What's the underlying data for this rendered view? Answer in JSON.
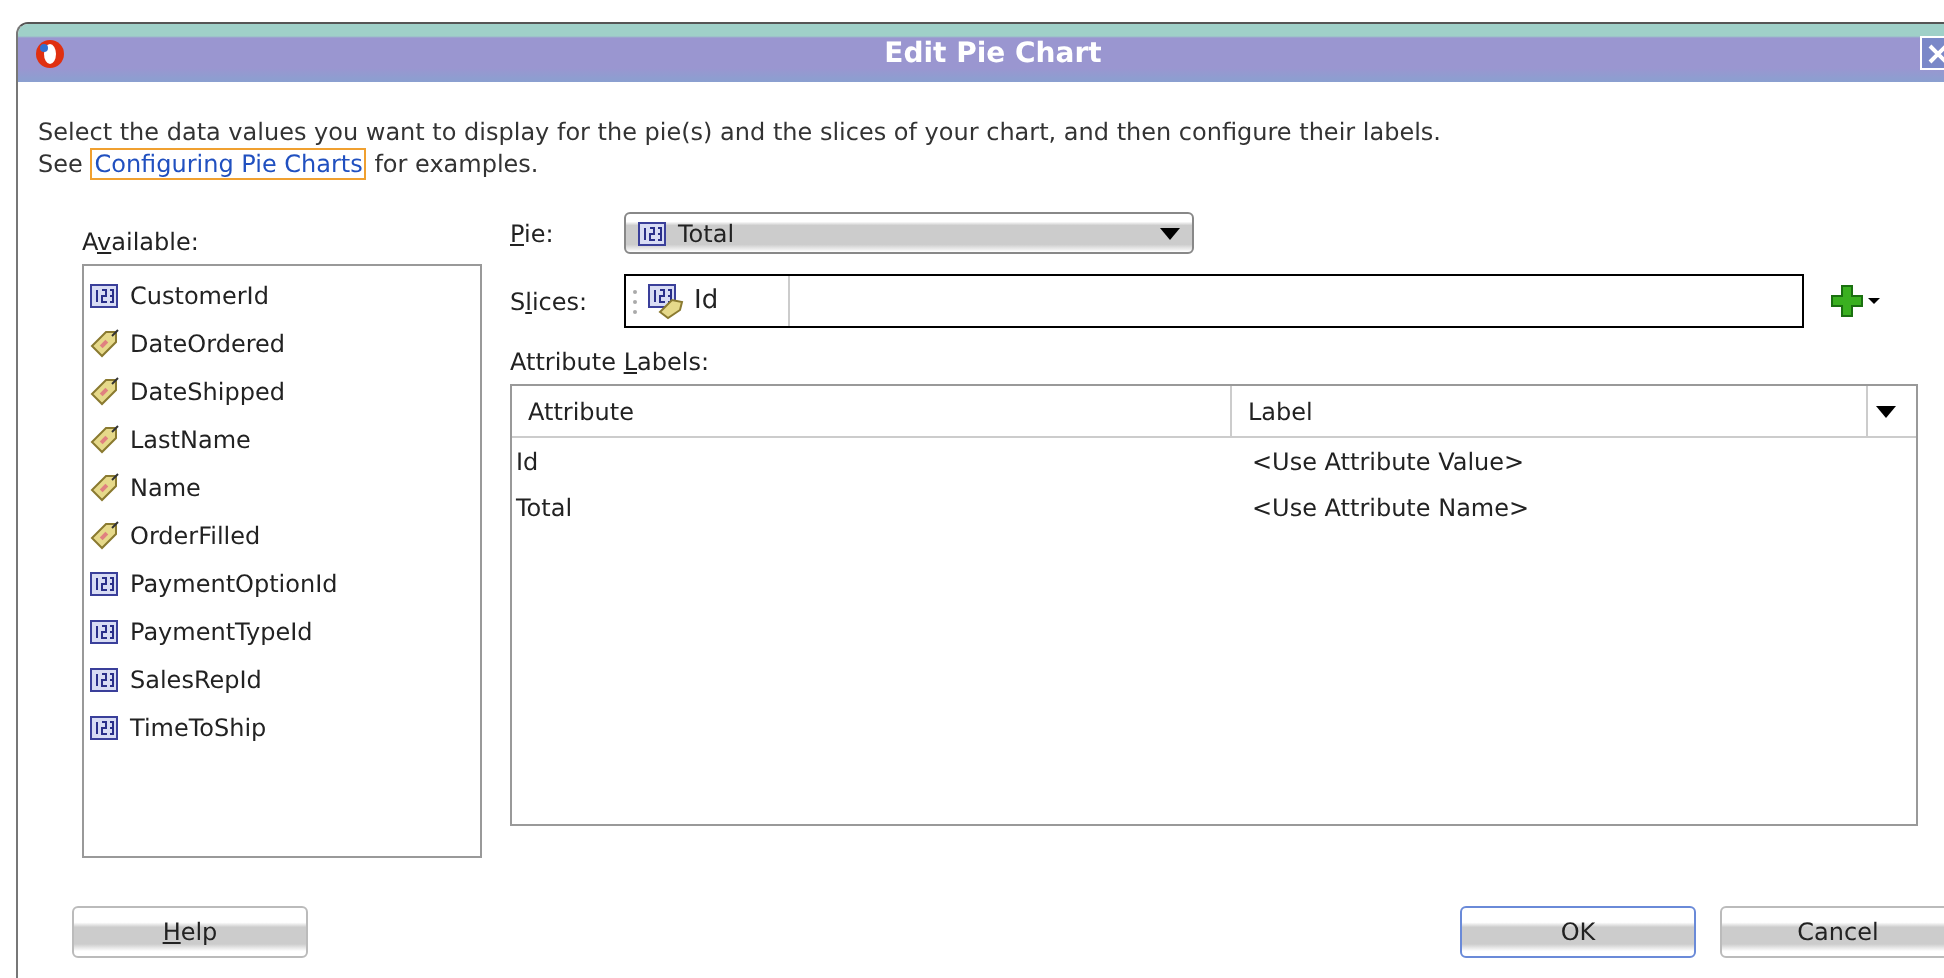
{
  "window": {
    "title": "Edit Pie Chart"
  },
  "intro": {
    "line_1": "Select the data values you want to display for the pie(s) and the slices of your chart, and then configure their labels.",
    "line_2_before": "See",
    "link": "Configuring Pie Charts",
    "line_2_after": "for examples."
  },
  "available": {
    "label_before": "A",
    "mnemonic": "v",
    "label_after": "ailable:",
    "items": [
      {
        "name": "CustomerId",
        "kind": "number"
      },
      {
        "name": "DateOrdered",
        "kind": "tag"
      },
      {
        "name": "DateShipped",
        "kind": "tag"
      },
      {
        "name": "LastName",
        "kind": "tag"
      },
      {
        "name": "Name",
        "kind": "tag"
      },
      {
        "name": "OrderFilled",
        "kind": "tag"
      },
      {
        "name": "PaymentOptionId",
        "kind": "number"
      },
      {
        "name": "PaymentTypeId",
        "kind": "number"
      },
      {
        "name": "SalesRepId",
        "kind": "number"
      },
      {
        "name": "TimeToShip",
        "kind": "number"
      }
    ]
  },
  "pie": {
    "mnemonic": "P",
    "label_after": "ie:",
    "value": "Total"
  },
  "slices": {
    "label_before": "S",
    "mnemonic": "l",
    "label_after": "ices:",
    "items": [
      "Id"
    ]
  },
  "attribute_labels": {
    "label_before": "Attribute ",
    "mnemonic": "L",
    "label_after": "abels:",
    "columns": [
      "Attribute",
      "Label"
    ],
    "rows": [
      {
        "attribute": "Id",
        "label": "<Use Attribute Value>"
      },
      {
        "attribute": "Total",
        "label": "<Use Attribute Name>"
      }
    ]
  },
  "buttons": [
    {
      "mnemonic": "H",
      "label_after": "elp",
      "default": false
    },
    {
      "label_before": "OK",
      "default": true
    },
    {
      "label_before": "Cancel",
      "default": false
    }
  ]
}
